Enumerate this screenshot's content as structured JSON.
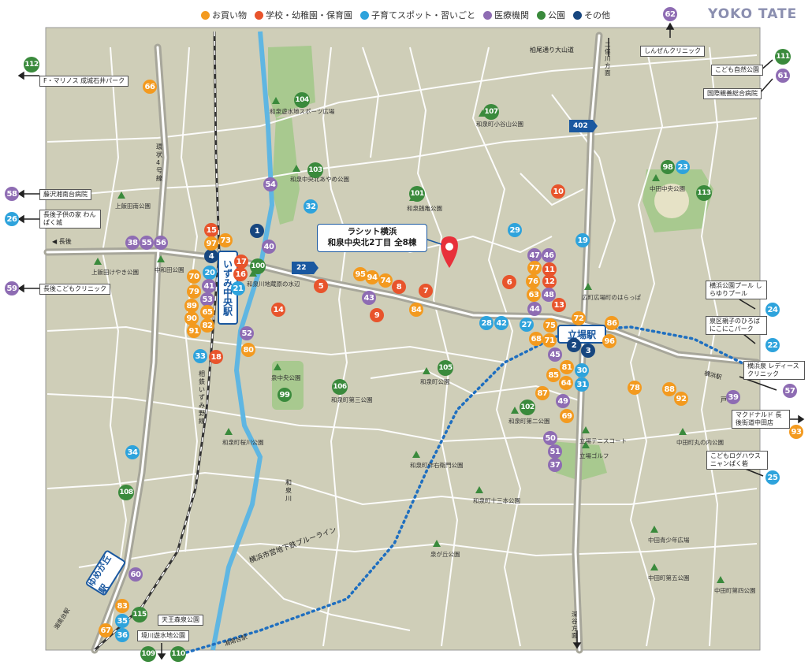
{
  "brand": "YOKO TATE",
  "legend": [
    {
      "label": "お買い物",
      "color": "#f39a1f"
    },
    {
      "label": "学校・幼稚園・保育園",
      "color": "#e8542c"
    },
    {
      "label": "子育てスポット・習いごと",
      "color": "#2ea3dc"
    },
    {
      "label": "医療機関",
      "color": "#8e6cb3"
    },
    {
      "label": "公園",
      "color": "#3a8a3c"
    },
    {
      "label": "その他",
      "color": "#17467f"
    }
  ],
  "property": {
    "line1": "ラシット横浜",
    "line2": "和泉中央北2丁目 全8棟",
    "pin_color": "#e8303a"
  },
  "stations": {
    "tachiba": "立場駅",
    "izumichuo": "いずみ中央駅",
    "yumegaoka": "ゆめが丘駅"
  },
  "roads": {
    "route22": "22",
    "route402": "402",
    "loop4": "環状4号線",
    "sotetsu": "相鉄いずみ野線",
    "subway": "横浜市営地下鉄ブルーライン",
    "izumigawa": "和泉川",
    "kashio": "柏尾通り大山道",
    "nagago": "長後",
    "totsuka": "戸塚",
    "futamata": "二俣川方面",
    "fukaya": "深谷方面",
    "shonandai_left": "湘南台駅",
    "shonandai_bottom": "湘南台駅",
    "yokohama_st": "横浜駅"
  },
  "edge_boxes": [
    {
      "id": "62",
      "text": "しんぜんクリニック"
    },
    {
      "id": "111",
      "text": "こども自然公園"
    },
    {
      "id": "61",
      "text": "国際親善総合病院"
    },
    {
      "id": "112",
      "text": "F・マリノス 成城石井パーク"
    },
    {
      "id": "58",
      "text": "藤沢湘南台病院"
    },
    {
      "id": "26",
      "text": "長後子供の家 わんぱく城"
    },
    {
      "id": "59",
      "text": "長後こどもクリニック"
    },
    {
      "id": "24",
      "text": "横浜公園プール しらゆりプール"
    },
    {
      "id": "22",
      "text": "泉区親子のひろば にこにこパーク"
    },
    {
      "id": "57",
      "text": "横浜泉 レディースクリニック"
    },
    {
      "id": "93",
      "text": "マクドナルド 長後街道中田店"
    },
    {
      "id": "25",
      "text": "こどもログハウス ニャンぱく砦"
    },
    {
      "id": "109",
      "text": "天王森泉公園"
    },
    {
      "id": "110",
      "text": "境川遊水地公園"
    }
  ],
  "places": [
    "和泉遊水地スポーツ広場",
    "和泉町小谷山公園",
    "上飯田南公園",
    "和泉中央北あやめ公園",
    "和泉銭亀公園",
    "中田中央公園",
    "上飯田けやき公園",
    "中和田公園",
    "和泉川地蔵原の水辺",
    "広町広場町のはらっぱ",
    "泉中央公園",
    "和泉町公園",
    "和泉町第三公園",
    "和泉町第二公園",
    "立場テニスコート",
    "立場ゴルフ",
    "中田町丸の内公園",
    "和泉町桜川公園",
    "和泉町作右衛門公園",
    "和泉町十三本公園",
    "泉が丘公園",
    "中田青少年広場",
    "中田町第五公園",
    "中田町第四公園"
  ],
  "markers": [
    {
      "n": "1",
      "cat": "other"
    },
    {
      "n": "2",
      "cat": "other"
    },
    {
      "n": "3",
      "cat": "other"
    },
    {
      "n": "4",
      "cat": "other"
    },
    {
      "n": "5",
      "cat": "school"
    },
    {
      "n": "6",
      "cat": "school"
    },
    {
      "n": "7",
      "cat": "school"
    },
    {
      "n": "8",
      "cat": "school"
    },
    {
      "n": "9",
      "cat": "school"
    },
    {
      "n": "10",
      "cat": "school"
    },
    {
      "n": "11",
      "cat": "school"
    },
    {
      "n": "12",
      "cat": "school"
    },
    {
      "n": "13",
      "cat": "school"
    },
    {
      "n": "14",
      "cat": "school"
    },
    {
      "n": "15",
      "cat": "school"
    },
    {
      "n": "16",
      "cat": "school"
    },
    {
      "n": "17",
      "cat": "school"
    },
    {
      "n": "18",
      "cat": "school"
    },
    {
      "n": "19",
      "cat": "kids"
    },
    {
      "n": "20",
      "cat": "kids"
    },
    {
      "n": "21",
      "cat": "kids"
    },
    {
      "n": "23",
      "cat": "kids"
    },
    {
      "n": "27",
      "cat": "kids"
    },
    {
      "n": "28",
      "cat": "kids"
    },
    {
      "n": "29",
      "cat": "kids"
    },
    {
      "n": "30",
      "cat": "kids"
    },
    {
      "n": "31",
      "cat": "kids"
    },
    {
      "n": "32",
      "cat": "kids"
    },
    {
      "n": "33",
      "cat": "kids"
    },
    {
      "n": "34",
      "cat": "kids"
    },
    {
      "n": "35",
      "cat": "kids"
    },
    {
      "n": "36",
      "cat": "kids"
    },
    {
      "n": "37",
      "cat": "med"
    },
    {
      "n": "38",
      "cat": "med"
    },
    {
      "n": "39",
      "cat": "med"
    },
    {
      "n": "40",
      "cat": "med"
    },
    {
      "n": "41",
      "cat": "med"
    },
    {
      "n": "42",
      "cat": "kids"
    },
    {
      "n": "43",
      "cat": "med"
    },
    {
      "n": "44",
      "cat": "med"
    },
    {
      "n": "45",
      "cat": "med"
    },
    {
      "n": "46",
      "cat": "med"
    },
    {
      "n": "47",
      "cat": "med"
    },
    {
      "n": "48",
      "cat": "med"
    },
    {
      "n": "49",
      "cat": "med"
    },
    {
      "n": "50",
      "cat": "med"
    },
    {
      "n": "51",
      "cat": "med"
    },
    {
      "n": "52",
      "cat": "med"
    },
    {
      "n": "53",
      "cat": "med"
    },
    {
      "n": "54",
      "cat": "med"
    },
    {
      "n": "55",
      "cat": "med"
    },
    {
      "n": "56",
      "cat": "med"
    },
    {
      "n": "60",
      "cat": "med"
    },
    {
      "n": "63",
      "cat": "shop"
    },
    {
      "n": "64",
      "cat": "shop"
    },
    {
      "n": "65",
      "cat": "shop"
    },
    {
      "n": "66",
      "cat": "shop"
    },
    {
      "n": "67",
      "cat": "shop"
    },
    {
      "n": "68",
      "cat": "shop"
    },
    {
      "n": "69",
      "cat": "shop"
    },
    {
      "n": "70",
      "cat": "shop"
    },
    {
      "n": "71",
      "cat": "shop"
    },
    {
      "n": "72",
      "cat": "shop"
    },
    {
      "n": "73",
      "cat": "shop"
    },
    {
      "n": "74",
      "cat": "shop"
    },
    {
      "n": "75",
      "cat": "shop"
    },
    {
      "n": "76",
      "cat": "shop"
    },
    {
      "n": "77",
      "cat": "shop"
    },
    {
      "n": "78",
      "cat": "shop"
    },
    {
      "n": "79",
      "cat": "shop"
    },
    {
      "n": "80",
      "cat": "shop"
    },
    {
      "n": "81",
      "cat": "shop"
    },
    {
      "n": "82",
      "cat": "shop"
    },
    {
      "n": "83",
      "cat": "shop"
    },
    {
      "n": "84",
      "cat": "shop"
    },
    {
      "n": "85",
      "cat": "shop"
    },
    {
      "n": "86",
      "cat": "shop"
    },
    {
      "n": "87",
      "cat": "shop"
    },
    {
      "n": "88",
      "cat": "shop"
    },
    {
      "n": "89",
      "cat": "shop"
    },
    {
      "n": "90",
      "cat": "shop"
    },
    {
      "n": "91",
      "cat": "shop"
    },
    {
      "n": "92",
      "cat": "shop"
    },
    {
      "n": "94",
      "cat": "shop"
    },
    {
      "n": "95",
      "cat": "shop"
    },
    {
      "n": "96",
      "cat": "shop"
    },
    {
      "n": "97",
      "cat": "shop"
    },
    {
      "n": "98",
      "cat": "park"
    },
    {
      "n": "99",
      "cat": "park"
    },
    {
      "n": "100",
      "cat": "park"
    },
    {
      "n": "101",
      "cat": "park"
    },
    {
      "n": "102",
      "cat": "park"
    },
    {
      "n": "103",
      "cat": "park"
    },
    {
      "n": "104",
      "cat": "park"
    },
    {
      "n": "105",
      "cat": "park"
    },
    {
      "n": "106",
      "cat": "park"
    },
    {
      "n": "107",
      "cat": "park"
    },
    {
      "n": "108",
      "cat": "park"
    },
    {
      "n": "113",
      "cat": "park"
    },
    {
      "n": "115",
      "cat": "park"
    }
  ]
}
